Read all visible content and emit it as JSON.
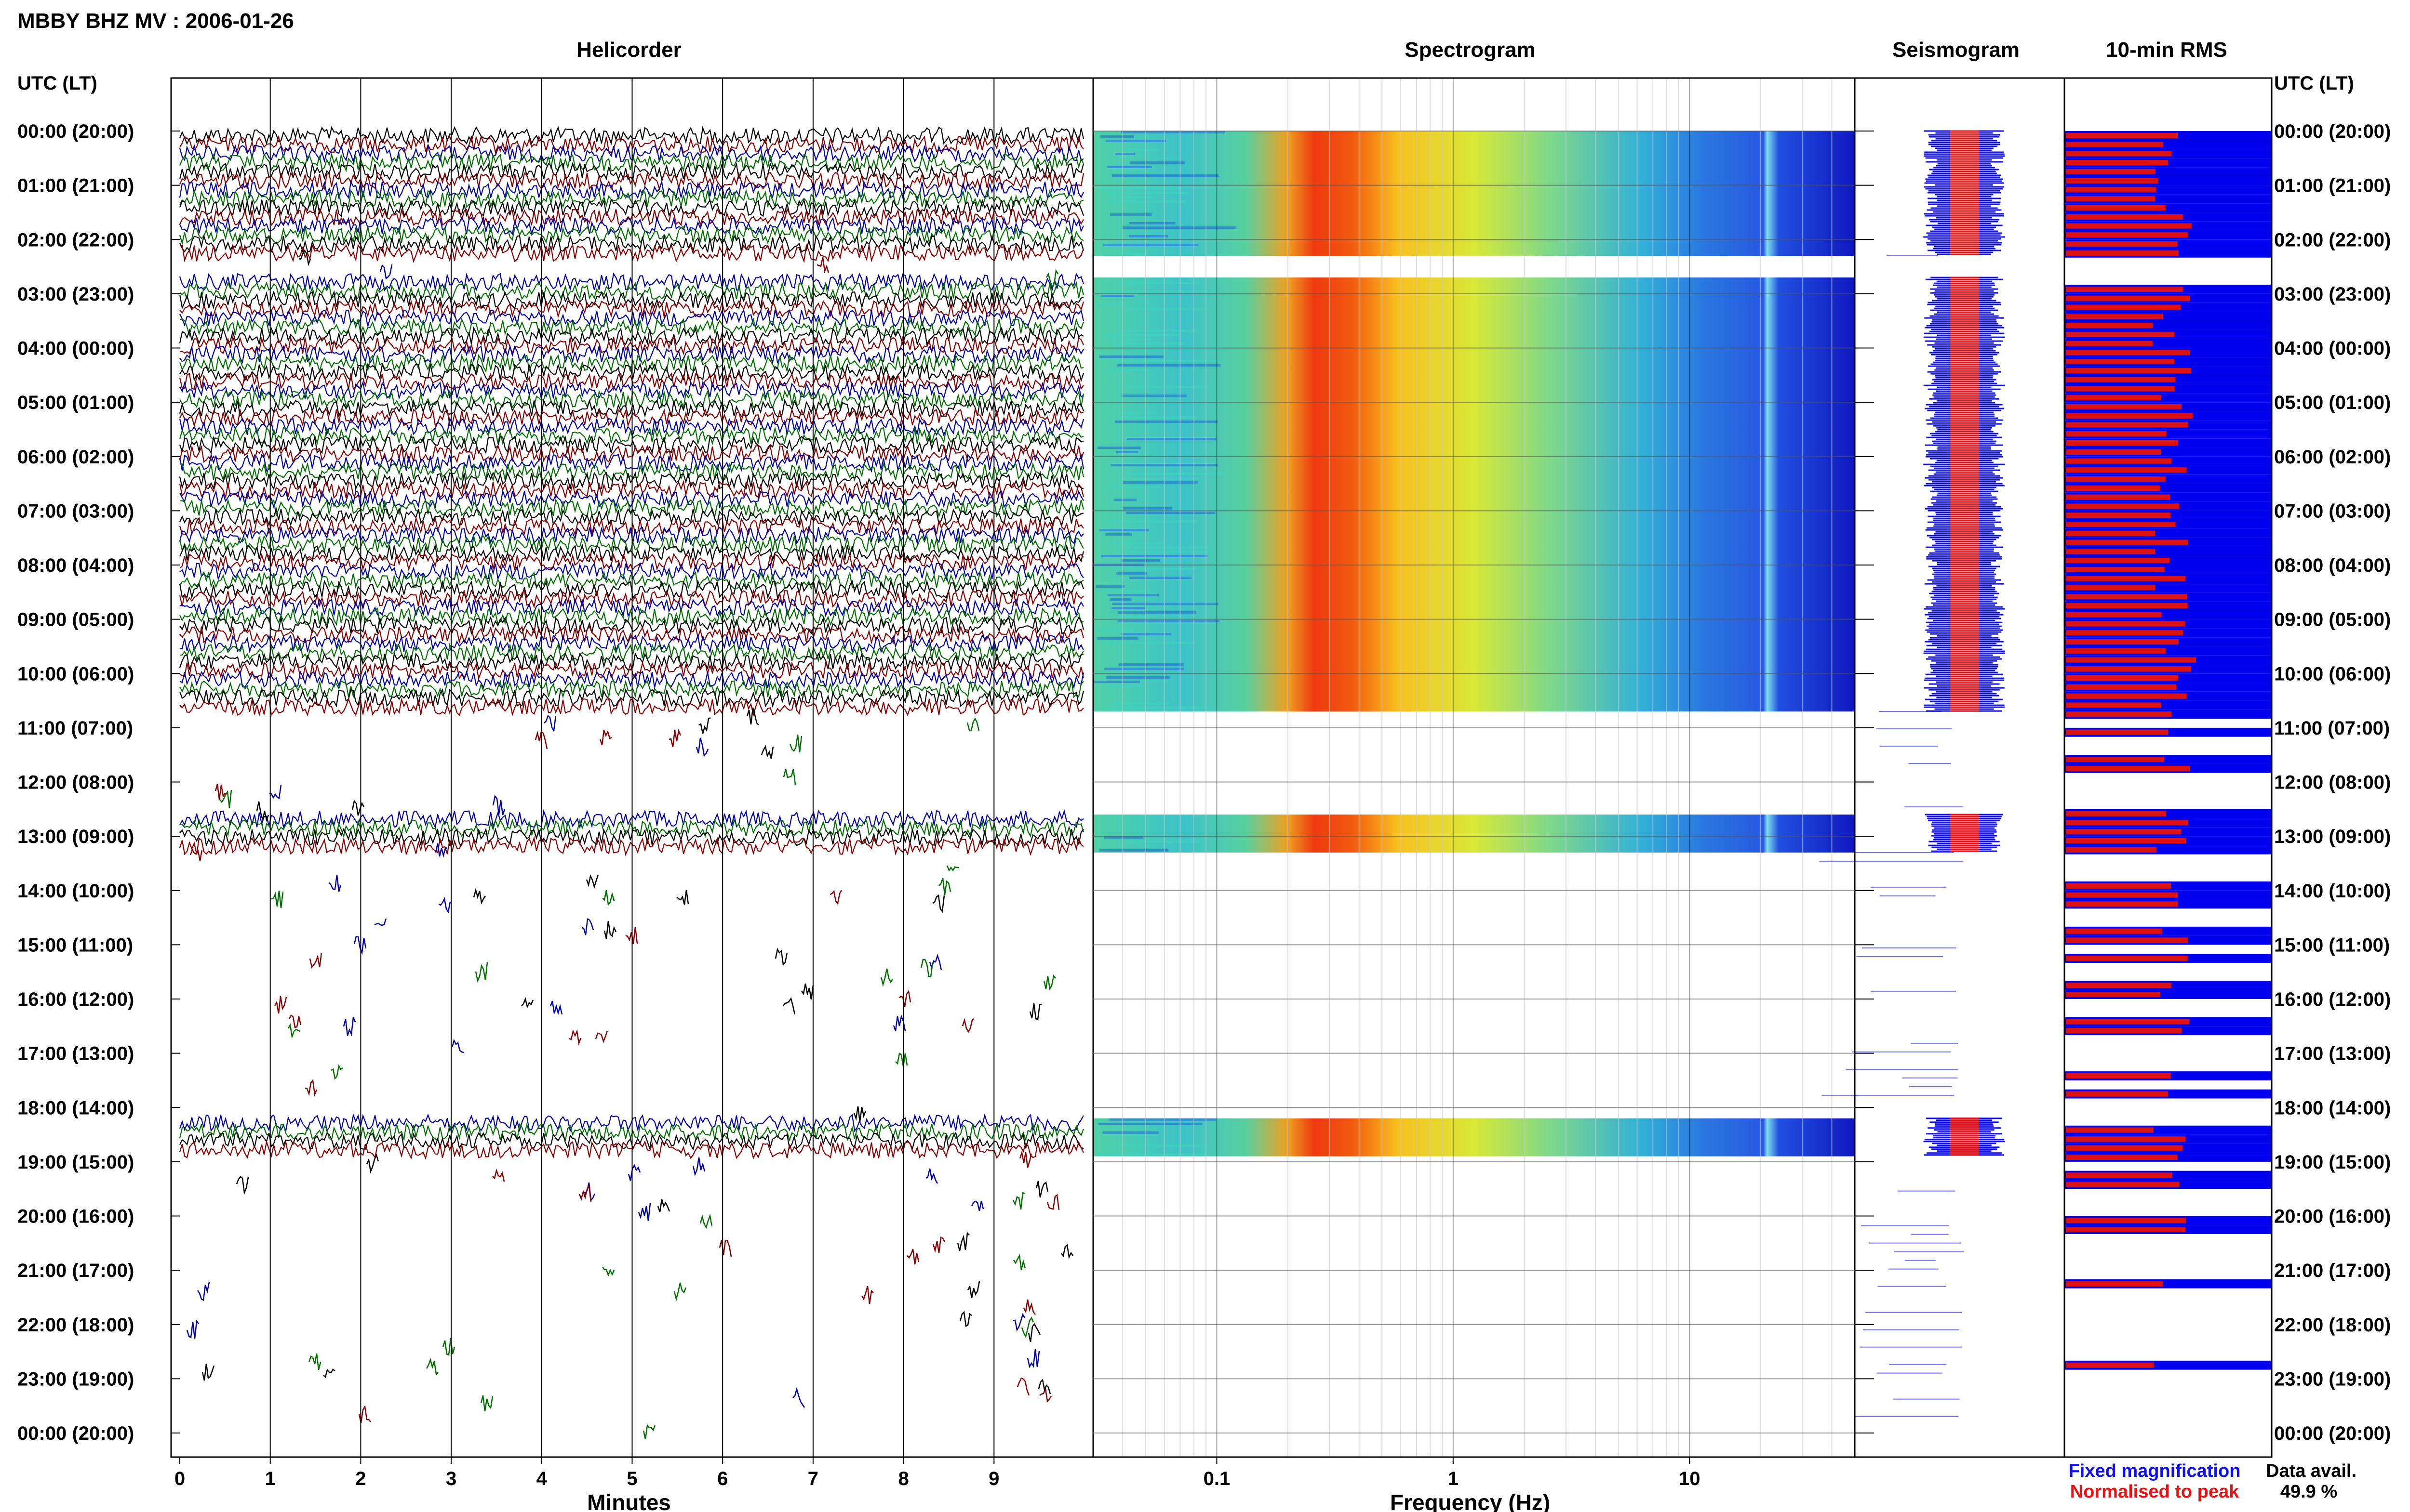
{
  "header": {
    "station_title": "MBBY BHZ MV : 2006-01-26"
  },
  "chart_data": {
    "type": "heatmap",
    "panels": {
      "helicorder": {
        "title": "Helicorder",
        "xlabel": "Minutes",
        "xticks": [
          "0",
          "1",
          "2",
          "3",
          "4",
          "5",
          "6",
          "7",
          "8",
          "9"
        ],
        "xlim": [
          0,
          10
        ],
        "trace_colors": [
          "#000000",
          "#8b0000",
          "#0000aa",
          "#007000"
        ]
      },
      "spectrogram": {
        "title": "Spectrogram",
        "xlabel": "Frequency (Hz)",
        "xscale": "log",
        "xticks": [
          "0.1",
          "1",
          "10"
        ],
        "xlim": [
          0.03,
          50
        ]
      },
      "seismogram": {
        "title": "Seismogram",
        "legend": [
          {
            "name": "Fixed magnification",
            "color": "#1010ee"
          },
          {
            "name": "Normalised to peak",
            "color": "#ee1010"
          }
        ]
      },
      "rms": {
        "title": "10-min RMS",
        "colors": {
          "fill": "#0000ee",
          "bar": "#dd1111"
        }
      }
    },
    "yaxis": {
      "label": "UTC (LT)",
      "ticks": [
        "00:00 (20:00)",
        "01:00 (21:00)",
        "02:00 (22:00)",
        "03:00 (23:00)",
        "04:00 (00:00)",
        "05:00 (01:00)",
        "06:00 (02:00)",
        "07:00 (03:00)",
        "08:00 (04:00)",
        "09:00 (05:00)",
        "10:00 (06:00)",
        "11:00 (07:00)",
        "12:00 (08:00)",
        "13:00 (09:00)",
        "14:00 (10:00)",
        "15:00 (11:00)",
        "16:00 (12:00)",
        "17:00 (13:00)",
        "18:00 (14:00)",
        "19:00 (15:00)",
        "20:00 (16:00)",
        "21:00 (17:00)",
        "22:00 (18:00)",
        "23:00 (19:00)",
        "00:00 (20:00)"
      ],
      "range_hours": [
        0,
        24
      ]
    },
    "data_segments_hours": [
      [
        0,
        2.3
      ],
      [
        2.7,
        10.7
      ],
      [
        12.6,
        13.3
      ],
      [
        18.2,
        18.9
      ]
    ],
    "gap_segments_hours": [
      [
        2.3,
        2.7
      ],
      [
        10.7,
        12.6
      ],
      [
        13.3,
        18.2
      ],
      [
        18.9,
        24.0
      ]
    ],
    "data_availability": {
      "label": "Data avail.",
      "value": "49.9 %"
    }
  }
}
